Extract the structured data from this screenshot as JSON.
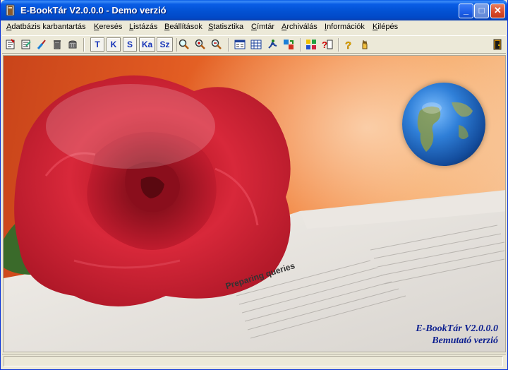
{
  "window": {
    "title": "E-BookTár V2.0.0.0 - Demo verzió",
    "controls": {
      "minimize": "_",
      "maximize": "□",
      "close": "✕"
    }
  },
  "menu": [
    "Adatbázis karbantartás",
    "Keresés",
    "Listázás",
    "Beállítások",
    "Statisztika",
    "Címtár",
    "Archiválás",
    "Információk",
    "Kilépés"
  ],
  "toolbar": {
    "letters": [
      "T",
      "K",
      "S",
      "Ka",
      "Sz"
    ],
    "icons": [
      "new-record-icon",
      "edit-record-icon",
      "brush-icon",
      "trash-icon",
      "delete-all-icon",
      "zoom-icon",
      "zoom-in-icon",
      "zoom-out-icon",
      "list-view-icon",
      "grid-view-icon",
      "running-man-icon",
      "swap-icon",
      "color-settings-icon",
      "help-index-icon",
      "help-icon",
      "hand-icon",
      "exit-door-icon"
    ]
  },
  "book": {
    "heading": "Preparing queries"
  },
  "caption": {
    "line1": "E-BookTár V2.0.0.0",
    "line2": "Bemutató verzió"
  },
  "colors": {
    "titlebar": "#0353d5",
    "background_orange": "#e05a22",
    "caption_blue": "#0c1f8f"
  }
}
